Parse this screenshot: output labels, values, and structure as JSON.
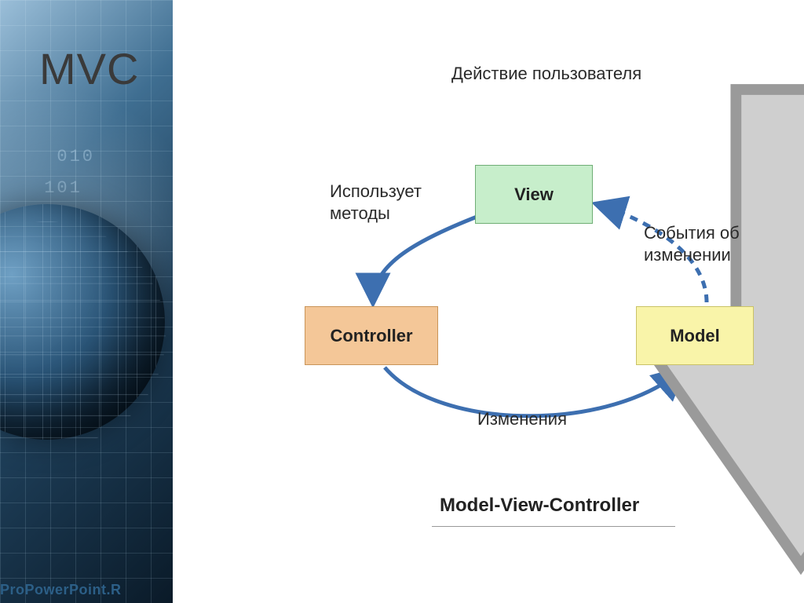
{
  "title": "MVC",
  "diagram": {
    "userActionLabel": "Действие пользователя",
    "nodes": {
      "view": "View",
      "controller": "Controller",
      "model": "Model"
    },
    "edgeLabels": {
      "viewToController": "Использует\nметоды",
      "modelToView": "События об\nизменении",
      "controllerToModel": "Изменения"
    },
    "caption": "Model-View-Controller"
  },
  "watermark": "ProPowerPoint.R"
}
